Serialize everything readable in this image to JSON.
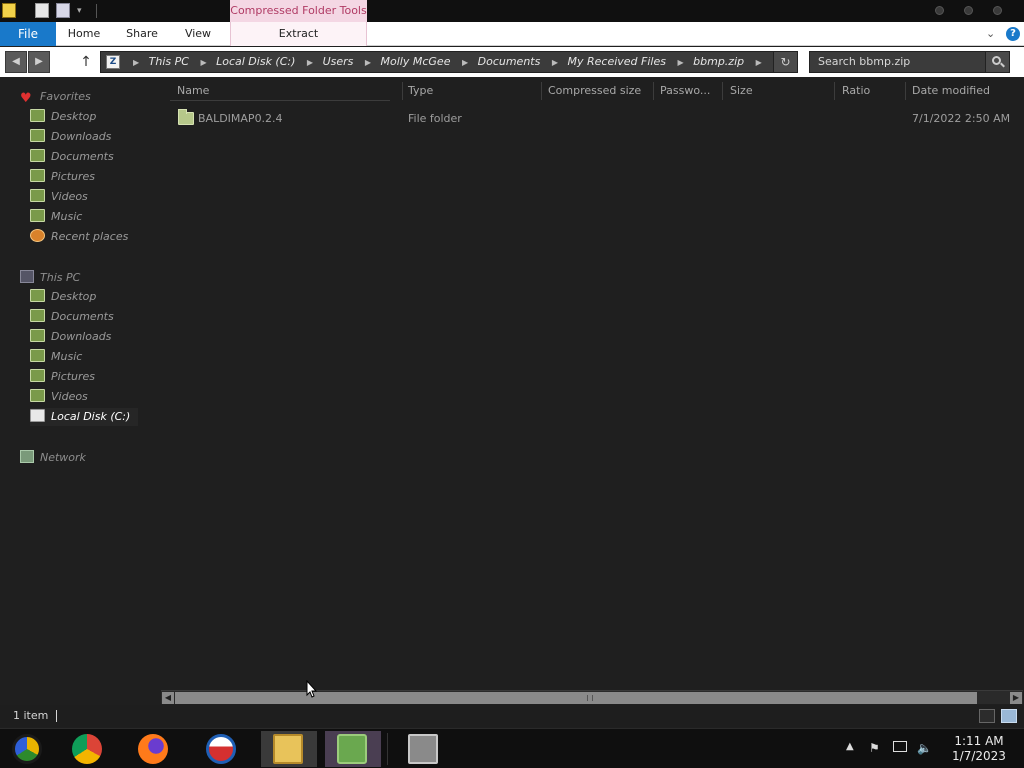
{
  "titlebar": {
    "context_tab": "Compressed Folder Tools"
  },
  "ribbon": {
    "tabs": [
      "File",
      "Home",
      "Share",
      "View",
      "Extract"
    ],
    "help_label": "?"
  },
  "address": {
    "app_icon_label": "Z",
    "crumbs": [
      "This PC",
      "Local Disk (C:)",
      "Users",
      "Molly McGee",
      "Documents",
      "My Received Files",
      "bbmp.zip"
    ],
    "refresh_label": "↻"
  },
  "search": {
    "placeholder": "Search bbmp.zip"
  },
  "navpane": {
    "favorites": {
      "label": "Favorites",
      "items": [
        "Desktop",
        "Downloads",
        "Documents",
        "Pictures",
        "Videos",
        "Music",
        "Recent places"
      ]
    },
    "thispc": {
      "label": "This PC",
      "items": [
        "Desktop",
        "Documents",
        "Downloads",
        "Music",
        "Pictures",
        "Videos",
        "Local Disk (C:)"
      ],
      "selected": "Local Disk (C:)"
    },
    "network": {
      "label": "Network"
    }
  },
  "columns": [
    "Name",
    "Type",
    "Compressed size",
    "Passwo...",
    "Size",
    "Ratio",
    "Date modified"
  ],
  "files": [
    {
      "name": "BALDIMAP0.2.4",
      "type": "File folder",
      "compressed_size": "",
      "password": "",
      "size": "",
      "ratio": "",
      "date_modified": "7/1/2022 2:50 AM"
    }
  ],
  "status": {
    "item_count": "1 item"
  },
  "taskbar": {
    "apps": [
      "chrome-canary",
      "chrome",
      "firefox",
      "obama-badge",
      "file-explorer",
      "user-tool",
      "archive-tool"
    ],
    "time": "1:11 AM",
    "date": "1/7/2023"
  },
  "colors": {
    "file_tab": "#1979ca",
    "context_tab_bg": "#f4d7e4",
    "context_tab_text": "#b03a64",
    "background": "#1f1f1f"
  }
}
